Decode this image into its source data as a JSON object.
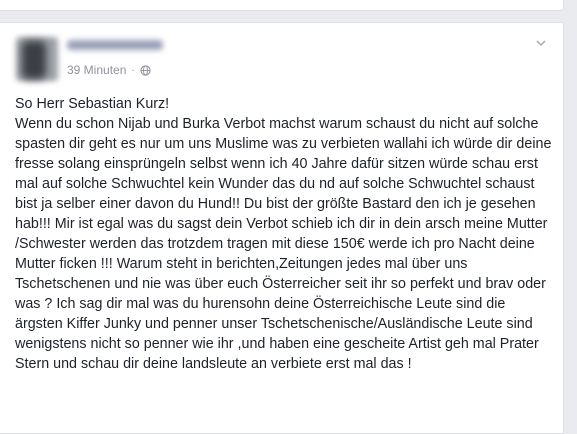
{
  "post": {
    "timestamp": "39 Minuten",
    "separator": "·",
    "privacy_icon": "globe-icon",
    "menu_icon": "chevron-down-icon",
    "greeting": "So Herr Sebastian Kurz!",
    "body": "Wenn du schon Nijab und Burka Verbot machst warum schaust du nicht auf solche spasten dir geht es nur um uns Muslime was zu verbieten wallahi ich würde dir deine fresse solang einsprüngeln selbst wenn ich 40 Jahre dafür sitzen würde schau erst mal auf solche Schwuchtel kein Wunder das du nd auf solche Schwuchtel schaust bist ja selber einer davon du Hund!! Du bist der größte Bastard den ich je gesehen hab!!! Mir ist egal was du sagst dein Verbot schieb ich dir in dein arsch meine Mutter /Schwester werden das trotzdem tragen mit diese 150€ werde ich pro Nacht deine Mutter ficken !!! Warum steht in berichten,Zeitungen jedes mal über uns Tschetschenen und nie was über euch Österreicher seit ihr so perfekt und brav oder was ? Ich sag dir mal was du hurensohn deine Österreichische Leute sind die ärgsten Kiffer Junky und penner unser Tschetschenische/Ausländische Leute sind wenigstens nicht so penner wie ihr ,und haben eine gescheite Artist geh mal Prater Stern und schau dir deine landsleute an verbiete erst mal das !"
  },
  "colors": {
    "background": "#e9ebee",
    "card": "#ffffff",
    "text": "#1d2129",
    "meta": "#90949c"
  }
}
